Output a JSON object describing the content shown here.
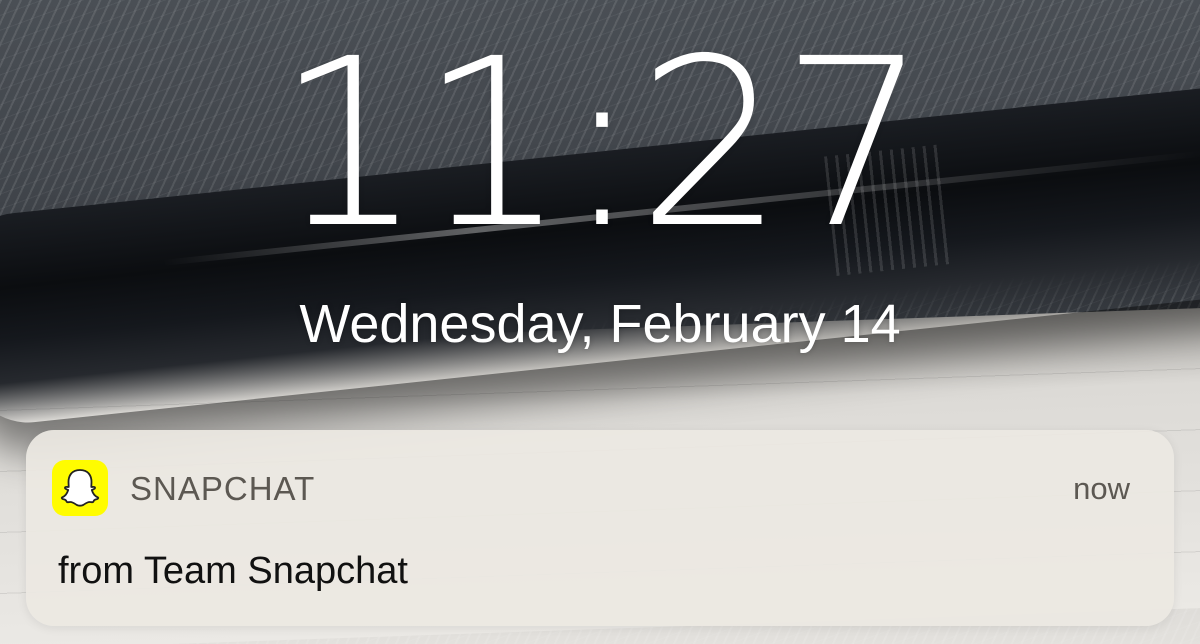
{
  "lock_screen": {
    "time": "11:27",
    "date": "Wednesday, February 14"
  },
  "notification": {
    "app_name": "SNAPCHAT",
    "time": "now",
    "message": "from Team Snapchat",
    "icon": "snapchat-ghost-icon",
    "icon_color": "#fffc00"
  }
}
